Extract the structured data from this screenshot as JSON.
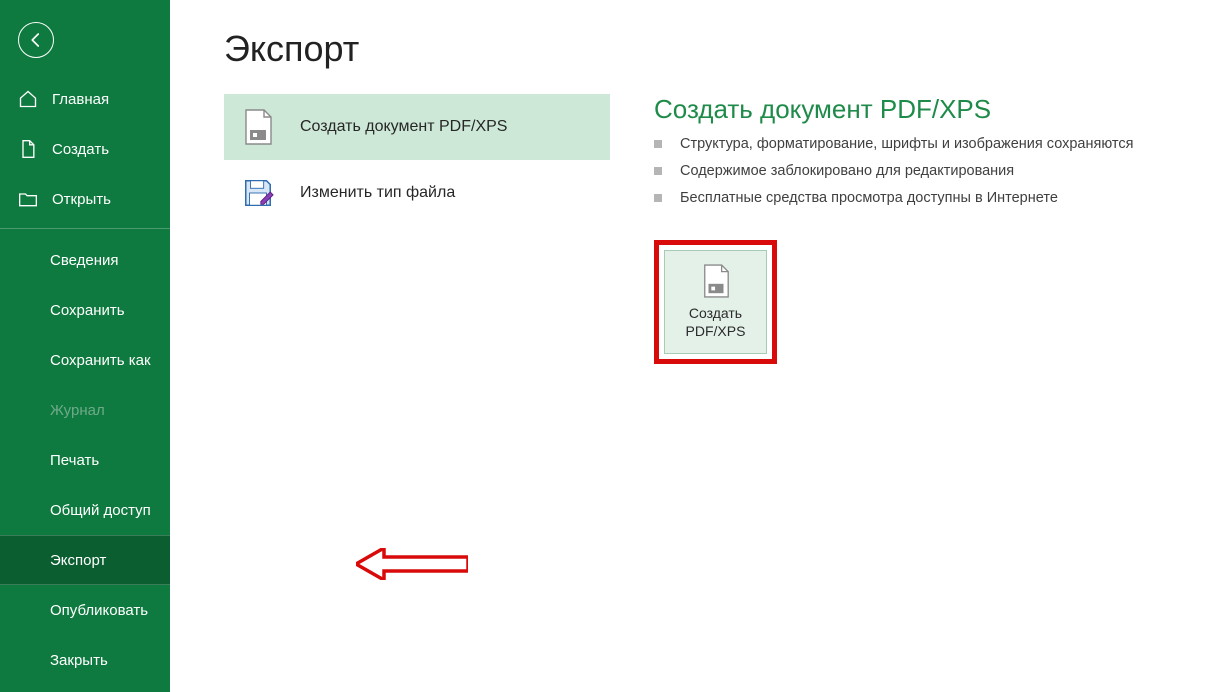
{
  "sidebar": {
    "items": {
      "home": {
        "label": "Главная"
      },
      "new": {
        "label": "Создать"
      },
      "open": {
        "label": "Открыть"
      },
      "info": {
        "label": "Сведения"
      },
      "save": {
        "label": "Сохранить"
      },
      "saveas": {
        "label": "Сохранить как"
      },
      "history": {
        "label": "Журнал"
      },
      "print": {
        "label": "Печать"
      },
      "share": {
        "label": "Общий доступ"
      },
      "export": {
        "label": "Экспорт"
      },
      "publish": {
        "label": "Опубликовать"
      },
      "close": {
        "label": "Закрыть"
      }
    }
  },
  "page": {
    "title": "Экспорт"
  },
  "options": {
    "create_pdf": {
      "label": "Создать документ PDF/XPS"
    },
    "change_type": {
      "label": "Изменить тип файла"
    }
  },
  "detail": {
    "heading": "Создать документ PDF/XPS",
    "bullets": [
      "Структура, форматирование, шрифты и изображения сохраняются",
      "Содержимое заблокировано для редактирования",
      "Бесплатные средства просмотра доступны в Интернете"
    ],
    "button_label": "Создать\nPDF/XPS"
  }
}
